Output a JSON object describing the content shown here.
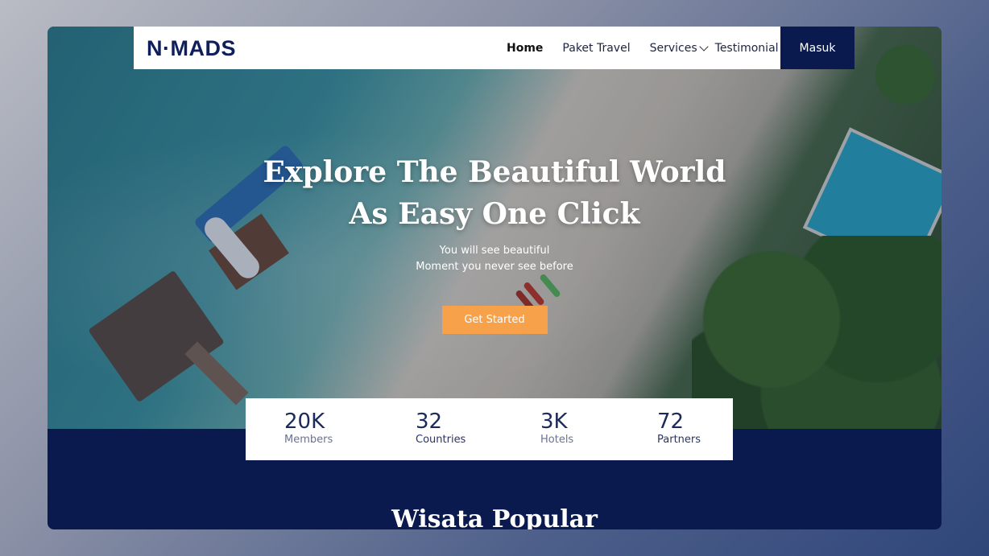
{
  "brand": {
    "logo_text": "N·MADS"
  },
  "nav": {
    "links": [
      {
        "label": "Home",
        "active": true
      },
      {
        "label": "Paket Travel"
      },
      {
        "label": "Services"
      },
      {
        "label": "Testimonial"
      }
    ],
    "login_label": "Masuk"
  },
  "hero": {
    "title_line1": "Explore The Beautiful World",
    "title_line2": "As Easy One Click",
    "subtitle_line1": "You will see beautiful",
    "subtitle_line2": "Moment you never see before",
    "cta_label": "Get Started"
  },
  "stats": [
    {
      "value": "20K",
      "label": "Members"
    },
    {
      "value": "32",
      "label": "Countries"
    },
    {
      "value": "3K",
      "label": "Hotels"
    },
    {
      "value": "72",
      "label": "Partners"
    }
  ],
  "section": {
    "title": "Wisata Popular"
  },
  "colors": {
    "navy": "#0b1a4e",
    "accent": "#f7a24b",
    "white": "#ffffff"
  }
}
